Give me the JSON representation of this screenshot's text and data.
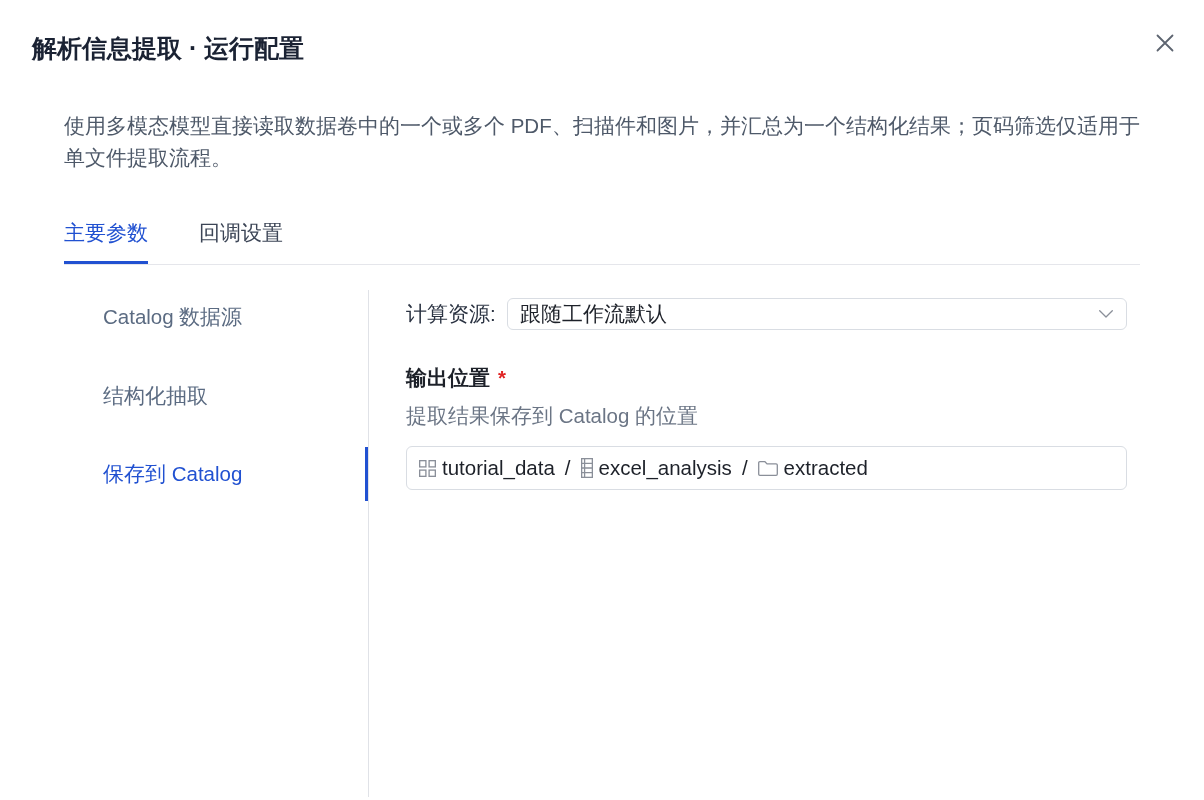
{
  "dialog": {
    "title": "解析信息提取 · 运行配置",
    "description": "使用多模态模型直接读取数据卷中的一个或多个 PDF、扫描件和图片，并汇总为一个结构化结果；页码筛选仅适用于单文件提取流程。"
  },
  "tabs": [
    {
      "label": "主要参数",
      "selected": true
    },
    {
      "label": "回调设置",
      "selected": false
    }
  ],
  "sidebar": {
    "items": [
      {
        "label": "Catalog 数据源",
        "selected": false
      },
      {
        "label": "结构化抽取",
        "selected": false
      },
      {
        "label": "保存到 Catalog",
        "selected": true
      }
    ]
  },
  "form": {
    "compute_resource": {
      "label": "计算资源:",
      "value": "跟随工作流默认"
    },
    "output_location": {
      "label": "输出位置",
      "required_mark": "*",
      "hint": "提取结果保存到 Catalog 的位置",
      "path": [
        {
          "kind": "catalog",
          "label": "tutorial_data"
        },
        {
          "kind": "separator",
          "label": "/"
        },
        {
          "kind": "schema",
          "label": "excel_analysis"
        },
        {
          "kind": "separator",
          "label": "/"
        },
        {
          "kind": "folder",
          "label": "extracted"
        }
      ]
    }
  }
}
